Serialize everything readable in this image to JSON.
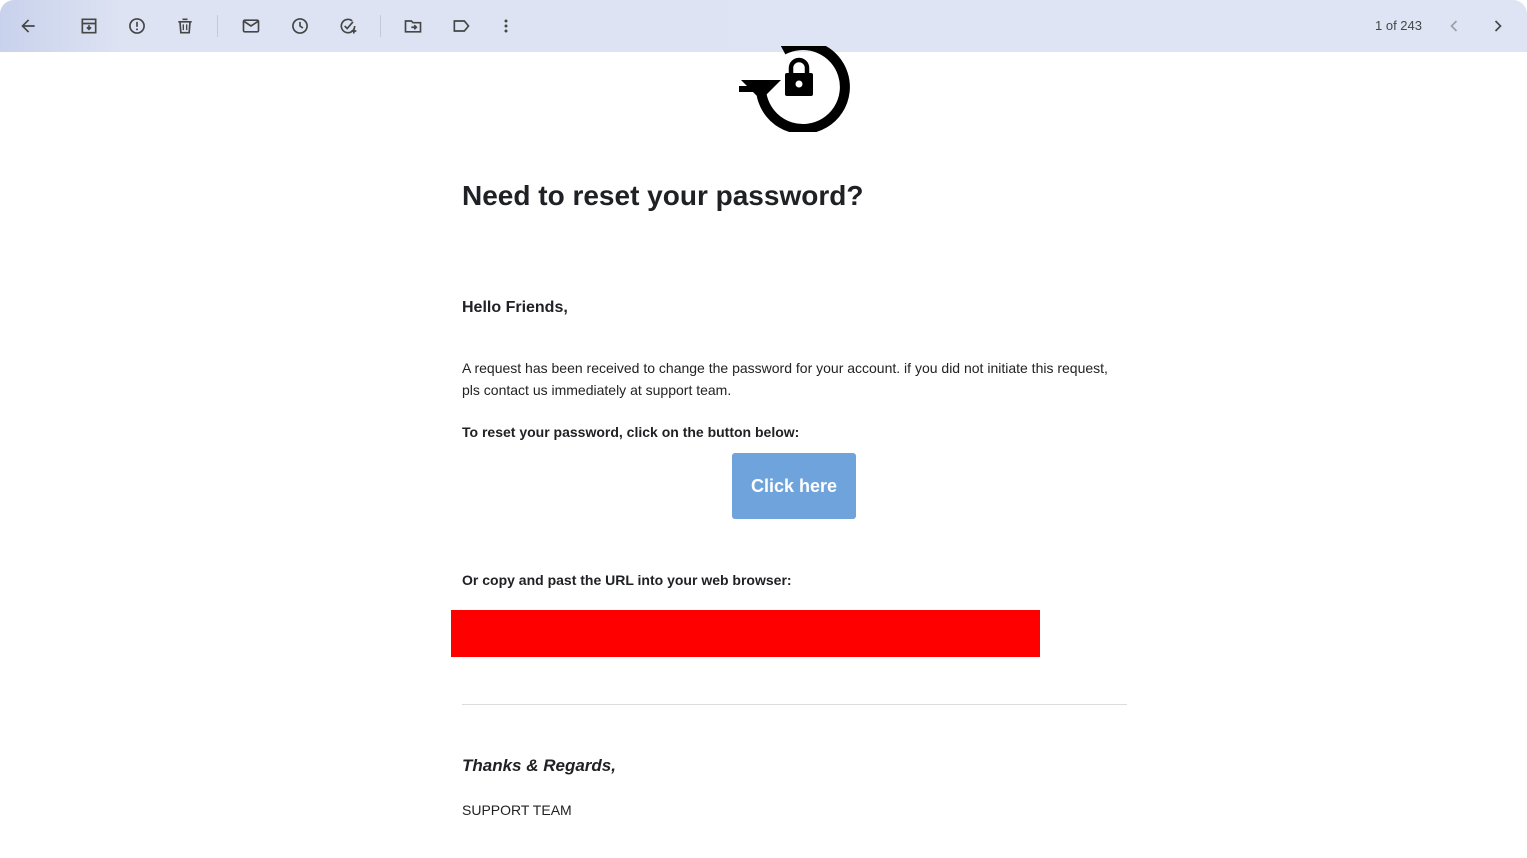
{
  "toolbar": {
    "icons": [
      "back-arrow-icon",
      "archive-icon",
      "report-spam-icon",
      "delete-icon",
      "mark-unread-icon",
      "snooze-icon",
      "add-task-icon",
      "move-to-icon",
      "label-icon",
      "more-vert-icon",
      "chevron-left-icon",
      "chevron-right-icon"
    ],
    "pager_text": "1 of 243"
  },
  "email": {
    "hero_icon": "lock-reset-icon",
    "headline": "Need to reset your password?",
    "greeting": "Hello Friends,",
    "body_text": "A request has been received to change the password for your account. if you did not initiate this request, pls contact us immediately at support team.",
    "instruction": "To reset your password, click on the button below:",
    "button_label": "Click here",
    "url_label": "Or copy and past the URL into your web browser:",
    "signoff": "Thanks & Regards,",
    "team": "SUPPORT TEAM"
  },
  "colors": {
    "toolbar_bg": "#dfe4f4",
    "button_bg": "#6fa3dc",
    "redaction": "#ff0000",
    "text": "#202124"
  }
}
